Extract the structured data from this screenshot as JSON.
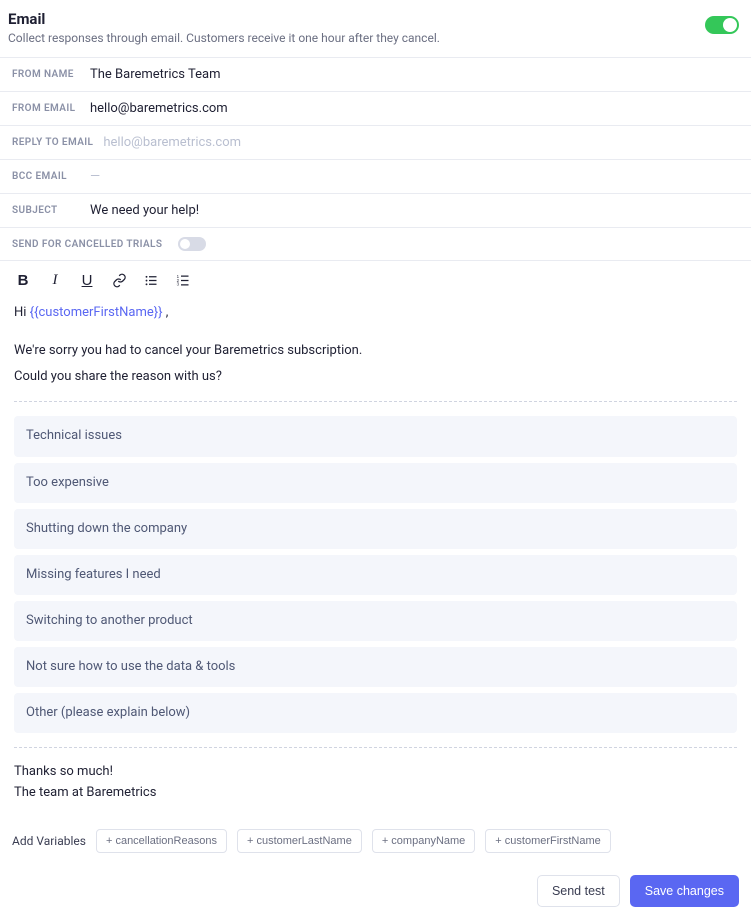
{
  "header": {
    "title": "Email",
    "subtitle": "Collect responses through email. Customers receive it one hour after they cancel."
  },
  "fields": {
    "from_name": {
      "label": "FROM NAME",
      "value": "The Baremetrics Team"
    },
    "from_email": {
      "label": "FROM EMAIL",
      "value": "hello@baremetrics.com"
    },
    "reply_to": {
      "label": "REPLY TO EMAIL",
      "placeholder": "hello@baremetrics.com"
    },
    "bcc": {
      "label": "BCC EMAIL",
      "value": "—"
    },
    "subject": {
      "label": "SUBJECT",
      "value": "We need your help!"
    },
    "send_cancelled": {
      "label": "SEND FOR CANCELLED TRIALS"
    }
  },
  "editor": {
    "greeting_prefix": "Hi ",
    "greeting_variable": "{{customerFirstName}}",
    "greeting_suffix": " ,",
    "intro_line1": "We're sorry you had to cancel your Baremetrics subscription.",
    "intro_line2": "Could you share the reason with us?",
    "reasons": [
      "Technical issues",
      "Too expensive",
      "Shutting down the company",
      "Missing features I need",
      "Switching to another product",
      "Not sure how to use the data & tools",
      "Other (please explain below)"
    ],
    "closing_line1": "Thanks so much!",
    "closing_line2": "The team at Baremetrics"
  },
  "variables": {
    "label": "Add Variables",
    "items": [
      "+ cancellationReasons",
      "+ customerLastName",
      "+ companyName",
      "+ customerFirstName"
    ]
  },
  "footer": {
    "send_test": "Send test",
    "save": "Save changes"
  }
}
